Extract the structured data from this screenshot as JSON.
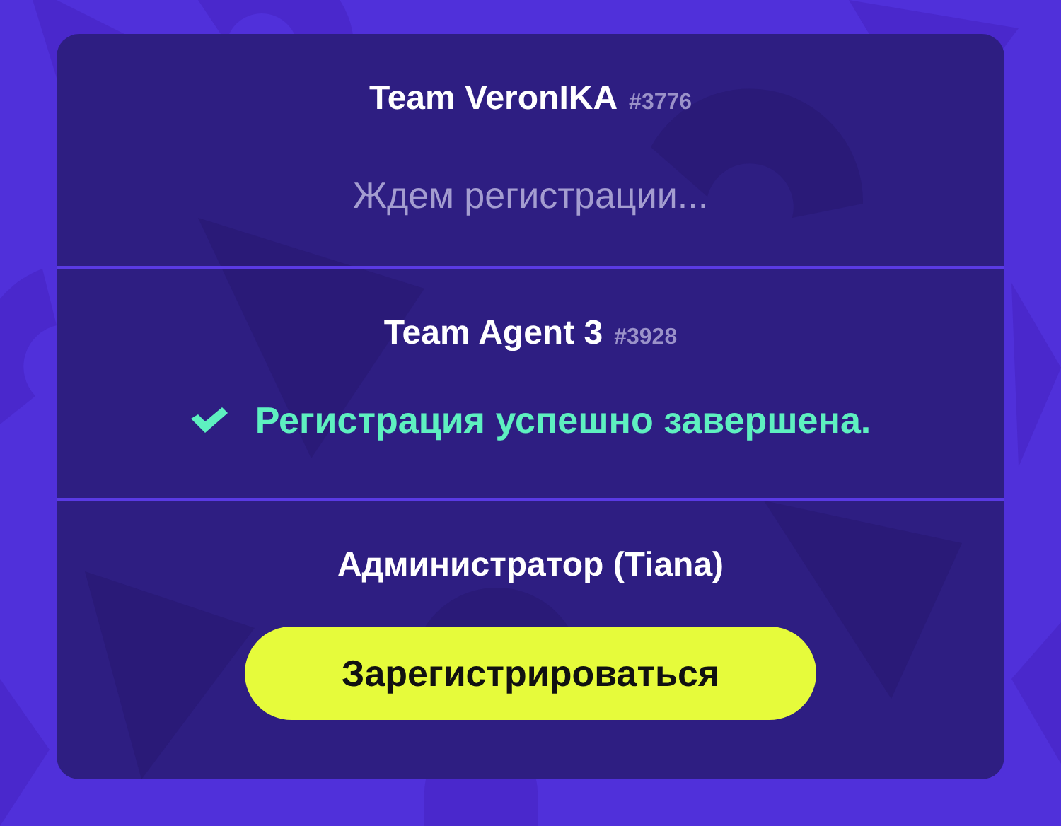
{
  "slots": [
    {
      "kind": "team",
      "name": "Team VeronIKA",
      "number": "#3776",
      "status": {
        "kind": "waiting",
        "text": "Ждем регистрации..."
      }
    },
    {
      "kind": "team",
      "name": "Team Agent 3",
      "number": "#3928",
      "status": {
        "kind": "done",
        "text": "Регистрация успешно завершена."
      }
    },
    {
      "kind": "admin",
      "name": "Администратор (Tiana)",
      "button": "Зарегистрироваться"
    }
  ]
}
